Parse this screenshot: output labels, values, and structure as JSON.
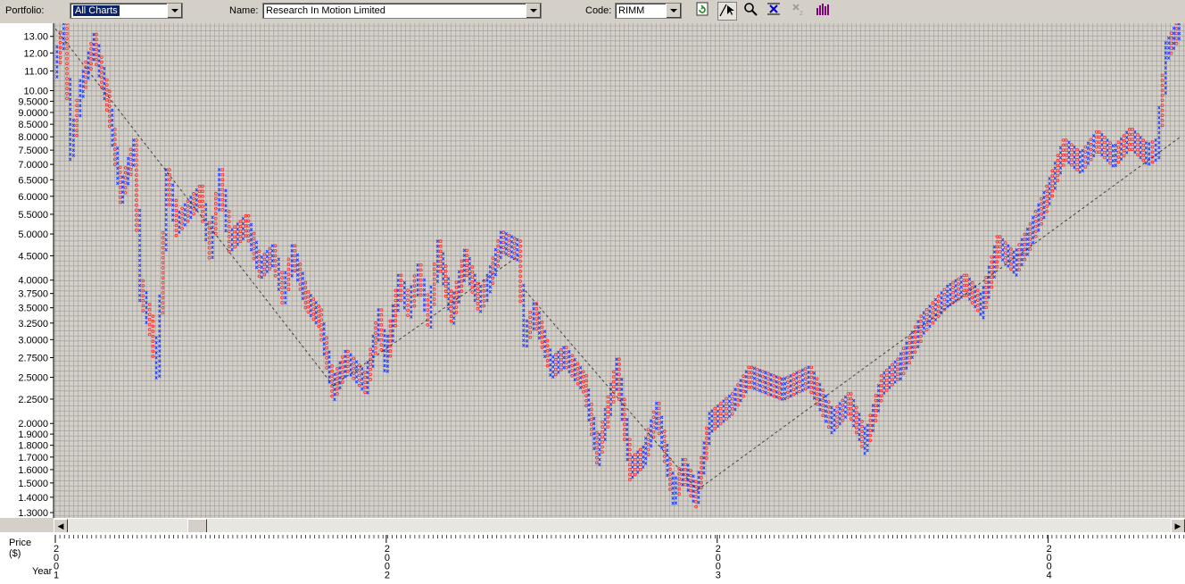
{
  "toolbar": {
    "portfolio_label": "Portfolio:",
    "portfolio_value": "All Charts",
    "name_label": "Name:",
    "name_value": "Research In Motion Limited",
    "code_label": "Code:",
    "code_value": "RIMM",
    "buttons": [
      "refresh-icon",
      "trendline-pointer-icon",
      "zoom-icon",
      "pf-x-icon",
      "pf-x-disabled-icon",
      "bar-chart-icon"
    ]
  },
  "axis": {
    "price_label": "Price",
    "price_unit": "($)",
    "year_label": "Year",
    "years": [
      "2001",
      "2002",
      "2003",
      "2004"
    ]
  },
  "colors": {
    "x_color": "#1e3cff",
    "o_color": "#ff3030",
    "grid": "#9a9a9a",
    "bg": "#d4d0c8"
  },
  "chart_data": {
    "type": "line",
    "subtype": "point-and-figure",
    "title": "",
    "xlabel": "Year",
    "ylabel": "Price ($)",
    "yscale": "log",
    "ylim": [
      1.3,
      13.5
    ],
    "y_ticks": [
      "13.00",
      "12.00",
      "11.00",
      "10.00",
      "9.5000",
      "9.0000",
      "8.5000",
      "8.0000",
      "7.5000",
      "7.0000",
      "6.5000",
      "6.0000",
      "5.5000",
      "5.0000",
      "4.5000",
      "4.0000",
      "3.7500",
      "3.5000",
      "3.2500",
      "3.0000",
      "2.7500",
      "2.5000",
      "2.2500",
      "2.0000",
      "1.9000",
      "1.8000",
      "1.7000",
      "1.6000",
      "1.5000",
      "1.4000",
      "1.3000"
    ],
    "x_ticks": [
      "2001",
      "2002",
      "2003",
      "2004"
    ],
    "series": [
      {
        "price_path": [
          [
            2001.0,
            11.0
          ],
          [
            2001.03,
            13.5
          ],
          [
            2001.05,
            7.5
          ],
          [
            2001.08,
            10.0
          ],
          [
            2001.12,
            12.5
          ],
          [
            2001.16,
            9.5
          ],
          [
            2001.2,
            6.0
          ],
          [
            2001.24,
            7.5
          ],
          [
            2001.26,
            3.8
          ],
          [
            2001.29,
            3.2
          ],
          [
            2001.31,
            2.6
          ],
          [
            2001.34,
            6.5
          ],
          [
            2001.37,
            5.2
          ],
          [
            2001.44,
            6.0
          ],
          [
            2001.47,
            4.6
          ],
          [
            2001.5,
            6.5
          ],
          [
            2001.53,
            4.8
          ],
          [
            2001.58,
            5.2
          ],
          [
            2001.62,
            4.2
          ],
          [
            2001.66,
            4.5
          ],
          [
            2001.69,
            3.7
          ],
          [
            2001.72,
            4.5
          ],
          [
            2001.76,
            3.6
          ],
          [
            2001.8,
            3.3
          ],
          [
            2001.84,
            2.35
          ],
          [
            2001.88,
            2.7
          ],
          [
            2001.94,
            2.4
          ],
          [
            2001.98,
            3.3
          ],
          [
            2002.0,
            2.7
          ],
          [
            2002.04,
            3.9
          ],
          [
            2002.07,
            3.5
          ],
          [
            2002.1,
            4.1
          ],
          [
            2002.13,
            3.3
          ],
          [
            2002.16,
            4.6
          ],
          [
            2002.2,
            3.4
          ],
          [
            2002.24,
            4.4
          ],
          [
            2002.28,
            3.6
          ],
          [
            2002.31,
            3.9
          ],
          [
            2002.35,
            4.8
          ],
          [
            2002.4,
            4.6
          ],
          [
            2002.42,
            3.0
          ],
          [
            2002.45,
            3.4
          ],
          [
            2002.5,
            2.6
          ],
          [
            2002.54,
            2.75
          ],
          [
            2002.6,
            2.4
          ],
          [
            2002.64,
            1.7
          ],
          [
            2002.7,
            2.6
          ],
          [
            2002.74,
            1.6
          ],
          [
            2002.78,
            1.7
          ],
          [
            2002.82,
            2.1
          ],
          [
            2002.87,
            1.4
          ],
          [
            2002.9,
            1.6
          ],
          [
            2002.94,
            1.4
          ],
          [
            2002.98,
            2.0
          ],
          [
            2003.05,
            2.2
          ],
          [
            2003.1,
            2.5
          ],
          [
            2003.2,
            2.35
          ],
          [
            2003.28,
            2.5
          ],
          [
            2003.35,
            2.0
          ],
          [
            2003.4,
            2.2
          ],
          [
            2003.45,
            1.8
          ],
          [
            2003.5,
            2.4
          ],
          [
            2003.55,
            2.6
          ],
          [
            2003.62,
            3.2
          ],
          [
            2003.7,
            3.7
          ],
          [
            2003.75,
            3.9
          ],
          [
            2003.8,
            3.5
          ],
          [
            2003.85,
            4.7
          ],
          [
            2003.9,
            4.3
          ],
          [
            2003.95,
            5.0
          ],
          [
            2004.0,
            6.0
          ],
          [
            2004.05,
            7.5
          ],
          [
            2004.1,
            7.0
          ],
          [
            2004.15,
            7.8
          ],
          [
            2004.2,
            7.2
          ],
          [
            2004.25,
            7.9
          ],
          [
            2004.3,
            7.3
          ],
          [
            2004.33,
            7.5
          ],
          [
            2004.36,
            12.0
          ],
          [
            2004.4,
            13.5
          ]
        ]
      }
    ],
    "trendlines": [
      {
        "from": [
          2001.0,
          13.5
        ],
        "to": [
          2001.84,
          2.4
        ]
      },
      {
        "from": [
          2001.84,
          2.4
        ],
        "to": [
          2002.4,
          4.5
        ]
      },
      {
        "from": [
          2002.42,
          3.8
        ],
        "to": [
          2002.94,
          1.45
        ]
      },
      {
        "from": [
          2002.94,
          1.45
        ],
        "to": [
          2004.4,
          8.0
        ]
      }
    ],
    "grid": true,
    "legend": "none"
  }
}
